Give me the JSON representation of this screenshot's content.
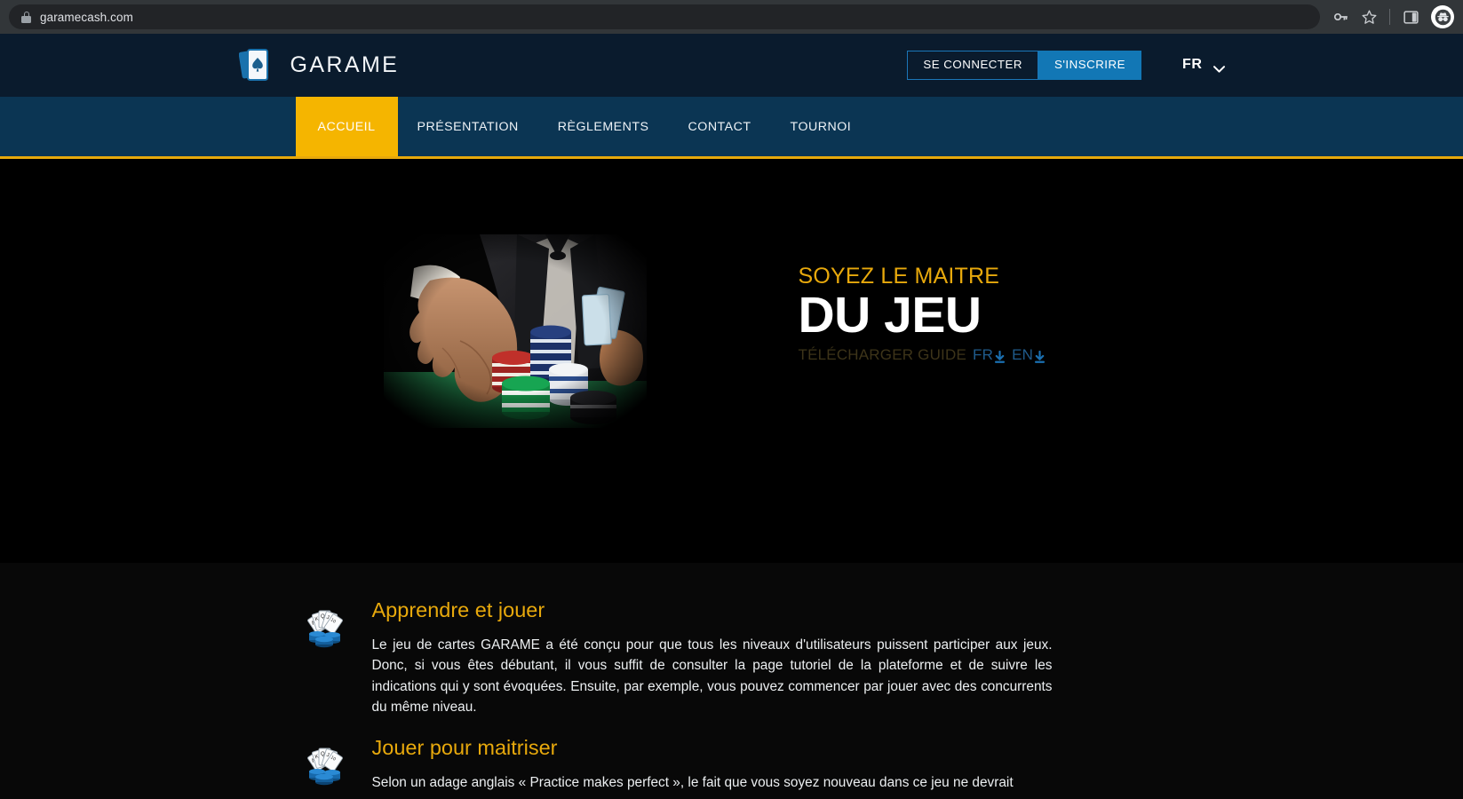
{
  "browser": {
    "url": "garamecash.com",
    "lock_icon": "lock-icon",
    "actions": [
      {
        "name": "password-manager-icon",
        "glyph": "key-icon"
      },
      {
        "name": "bookmark-star-icon",
        "glyph": "star-icon"
      },
      {
        "name": "side-panel-icon",
        "glyph": "panel-icon"
      },
      {
        "name": "incognito-avatar",
        "glyph": "incognito-icon"
      }
    ]
  },
  "header": {
    "brand_name": "GARAME",
    "brand_icon": "playing-cards-icon",
    "login_label": "SE CONNECTER",
    "signup_label": "S'INSCRIRE",
    "language": "FR",
    "language_chevron": "chevron-down-icon"
  },
  "nav": {
    "items": [
      {
        "label": "ACCUEIL",
        "active": true
      },
      {
        "label": "PRÉSENTATION",
        "active": false
      },
      {
        "label": "RÈGLEMENTS",
        "active": false
      },
      {
        "label": "CONTACT",
        "active": false
      },
      {
        "label": "TOURNOI",
        "active": false
      }
    ]
  },
  "hero": {
    "kicker": "SOYEZ LE MAITRE",
    "title": "DU JEU",
    "download_label": "TÉLÉCHARGER GUIDE",
    "download_fr": "FR",
    "download_en": "EN",
    "image_alt": "poker-player-chips-photo"
  },
  "features": [
    {
      "icon": "card-fan-chips-icon",
      "title": "Apprendre et jouer",
      "text": "Le jeu de cartes GARAME a été conçu pour que tous les niveaux d'utilisateurs puissent participer aux jeux. Donc, si vous êtes débutant, il vous suffit de consulter la page tutoriel de la plateforme et de suivre les indications qui y sont évoquées. Ensuite, par exemple, vous pouvez commencer par jouer avec des concurrents du même niveau."
    },
    {
      "icon": "card-fan-chips-icon",
      "title": "Jouer pour maitriser",
      "text": "Selon un adage anglais « Practice makes perfect », le fait que vous soyez nouveau dans ce jeu ne devrait"
    }
  ],
  "colors": {
    "page_bg": "#0a1b2d",
    "nav_bg": "#0b3553",
    "accent_gold": "#e8a90c",
    "active_gold": "#f5b500",
    "accent_blue": "#1277b5",
    "hero_bg": "#000000"
  }
}
